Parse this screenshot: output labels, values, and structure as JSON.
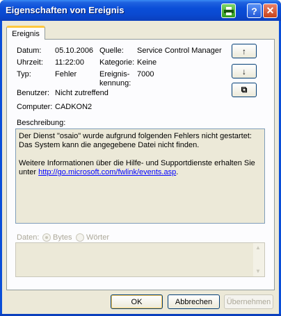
{
  "window": {
    "title": "Eigenschaften von Ereignis"
  },
  "titlebar": {
    "help_label": "?",
    "close_label": "✕"
  },
  "tab": {
    "label": "Ereignis"
  },
  "fields": {
    "datum_label": "Datum:",
    "datum_value": "05.10.2006",
    "uhrzeit_label": "Uhrzeit:",
    "uhrzeit_value": "11:22:00",
    "typ_label": "Typ:",
    "typ_value": "Fehler",
    "benutzer_label": "Benutzer:",
    "benutzer_value": "Nicht zutreffend",
    "computer_label": "Computer:",
    "computer_value": "CADKON2",
    "quelle_label": "Quelle:",
    "quelle_value": "Service Control Manager",
    "kategorie_label": "Kategorie:",
    "kategorie_value": "Keine",
    "ereignis_label_1": "Ereignis-",
    "ereignis_label_2": "kennung:",
    "ereignis_value": "7000"
  },
  "side_buttons": {
    "up": "↑",
    "down": "↓",
    "copy": "⧉"
  },
  "description": {
    "label": "Beschreibung:",
    "line1": "Der Dienst \"osaio\" wurde aufgrund folgenden Fehlers nicht gestartet:",
    "line2": "Das System kann die angegebene Datei nicht finden.",
    "line3": "Weitere Informationen über die Hilfe- und Supportdienste erhalten Sie",
    "line4_prefix": "unter ",
    "link": "http://go.microsoft.com/fwlink/events.asp",
    "line4_suffix": "."
  },
  "data": {
    "label": "Daten:",
    "option_bytes": "Bytes",
    "option_words": "Wörter",
    "selected": "Bytes"
  },
  "buttons": {
    "ok": "OK",
    "cancel": "Abbrechen",
    "apply": "Übernehmen"
  },
  "colors": {
    "title_bar": "#0a4ed8",
    "body": "#ece9d8",
    "link": "#0000ff",
    "tab_highlight": "#ffc83c"
  }
}
